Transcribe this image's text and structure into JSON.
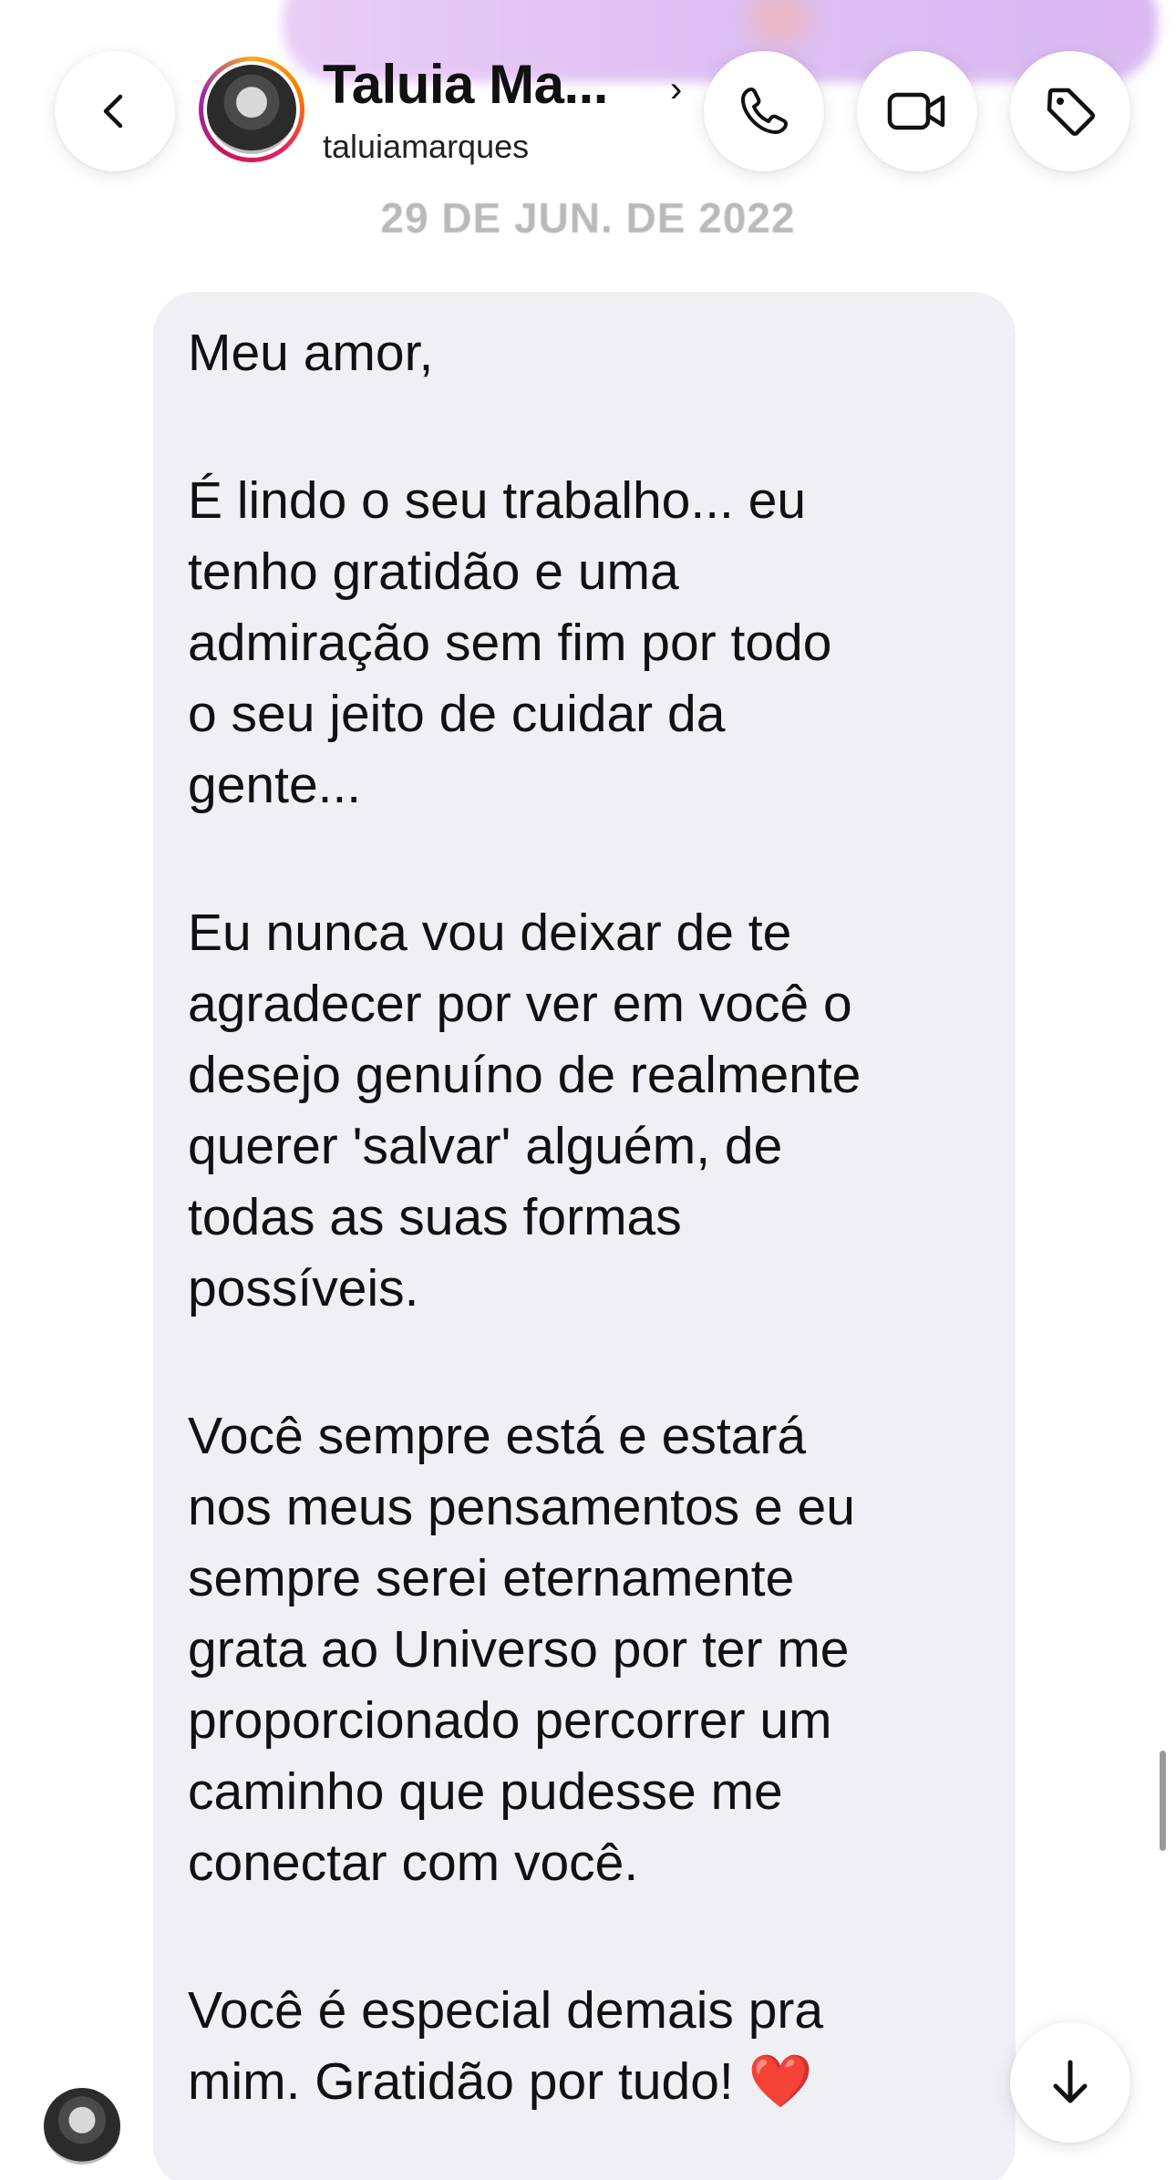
{
  "header": {
    "back_icon": "chevron-left-icon",
    "contact_name": "Taluia Ma...",
    "contact_name_chevron": "›",
    "contact_handle": "taluiamarques",
    "call_icon": "phone-icon",
    "video_icon": "video-camera-icon",
    "tag_icon": "tag-icon"
  },
  "conversation": {
    "date": "29 DE JUN. DE 2022",
    "message": {
      "paragraphs": [
        [
          "Meu amor,"
        ],
        [
          "É lindo o seu trabalho... eu",
          "tenho gratidão e uma",
          "admiração sem fim por todo",
          "o seu jeito de cuidar da",
          "gente..."
        ],
        [
          "Eu nunca vou deixar de te",
          "agradecer por ver em você o",
          "desejo genuíno de realmente",
          "querer 'salvar' alguém, de",
          "todas as suas formas",
          "possíveis."
        ],
        [
          "Você sempre está e estará",
          "nos meus pensamentos e eu",
          "sempre serei eternamente",
          "grata ao Universo por ter me",
          "proporcionado percorrer um",
          "caminho que pudesse me",
          "conectar com você."
        ],
        [
          "Você é especial demais pra",
          "mim. Gratidão por tudo! ❤️"
        ]
      ]
    },
    "scroll_down_icon": "arrow-down-icon"
  },
  "colors": {
    "bubble_bg": "#efeff4",
    "date_text": "#b9b9bd",
    "heart": "#e0245e"
  }
}
